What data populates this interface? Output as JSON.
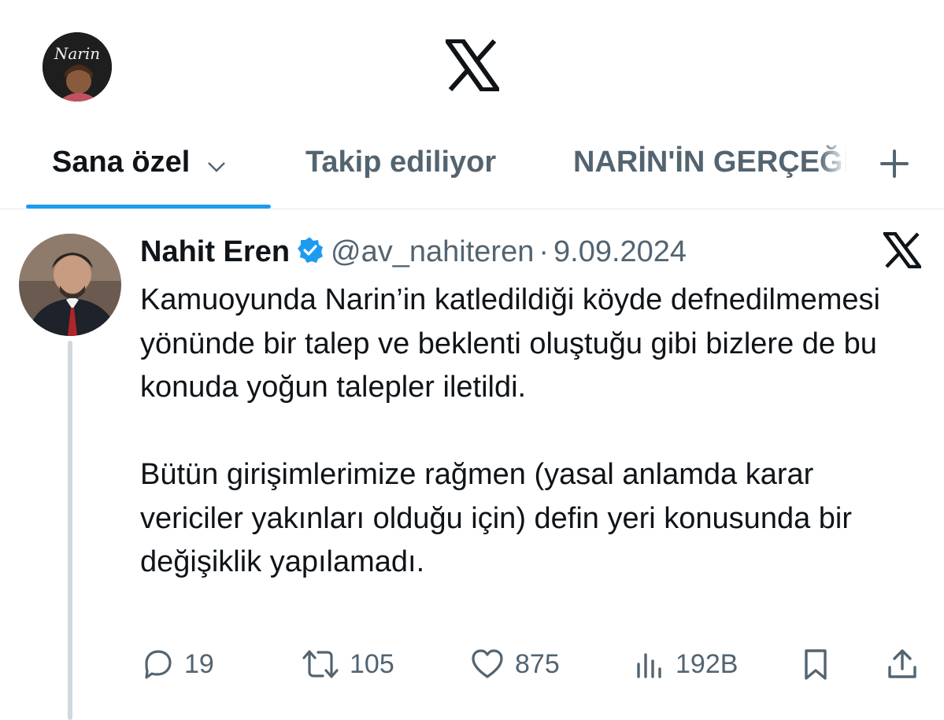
{
  "profile": {
    "avatar_text": "Narin"
  },
  "tabs": {
    "for_you": "Sana özel",
    "following": "Takip ediliyor",
    "list": "NARİN'İN GERÇEĞİ"
  },
  "tweet": {
    "author_name": "Nahit Eren",
    "author_handle": "@av_nahiteren",
    "separator": "·",
    "date": "9.09.2024",
    "paragraph_1": "Kamuoyunda Narin’in katledildiği köyde defnedilmemesi yönünde bir talep ve beklenti oluştuğu gibi bizlere de bu konuda yoğun talepler iletildi.",
    "paragraph_2": "Bütün girişimlerimize rağmen (yasal anlamda karar vericiler yakınları olduğu için) defin yeri konusunda bir değişiklik yapılamadı.",
    "actions": {
      "replies": "19",
      "reposts": "105",
      "likes": "875",
      "views": "192B"
    }
  },
  "icons": {
    "logo": "x-logo-icon",
    "tab_menu": "chevron-down-icon",
    "add_tab": "plus-icon",
    "verified": "verified-badge-icon",
    "reply": "comment-bubble-icon",
    "repost": "repost-arrows-icon",
    "like": "heart-icon",
    "views": "views-bar-icon",
    "bookmark": "bookmark-icon",
    "share": "share-upload-icon"
  },
  "colors": {
    "accent": "#1d9bf0",
    "text_primary": "#0f1419",
    "text_secondary": "#536471",
    "thread_line": "#cfd9de"
  }
}
